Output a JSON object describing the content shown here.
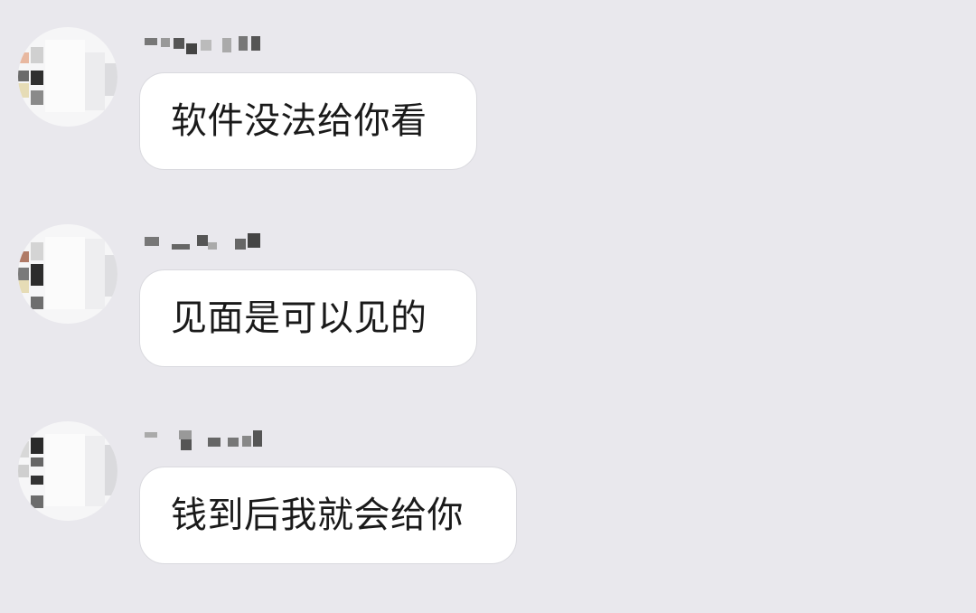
{
  "messages": [
    {
      "text": "软件没法给你看"
    },
    {
      "text": "见面是可以见的"
    },
    {
      "text": "钱到后我就会给你"
    }
  ],
  "colors": {
    "background": "#e9e8ed",
    "bubble": "#ffffff",
    "text": "#1a1a1a"
  }
}
